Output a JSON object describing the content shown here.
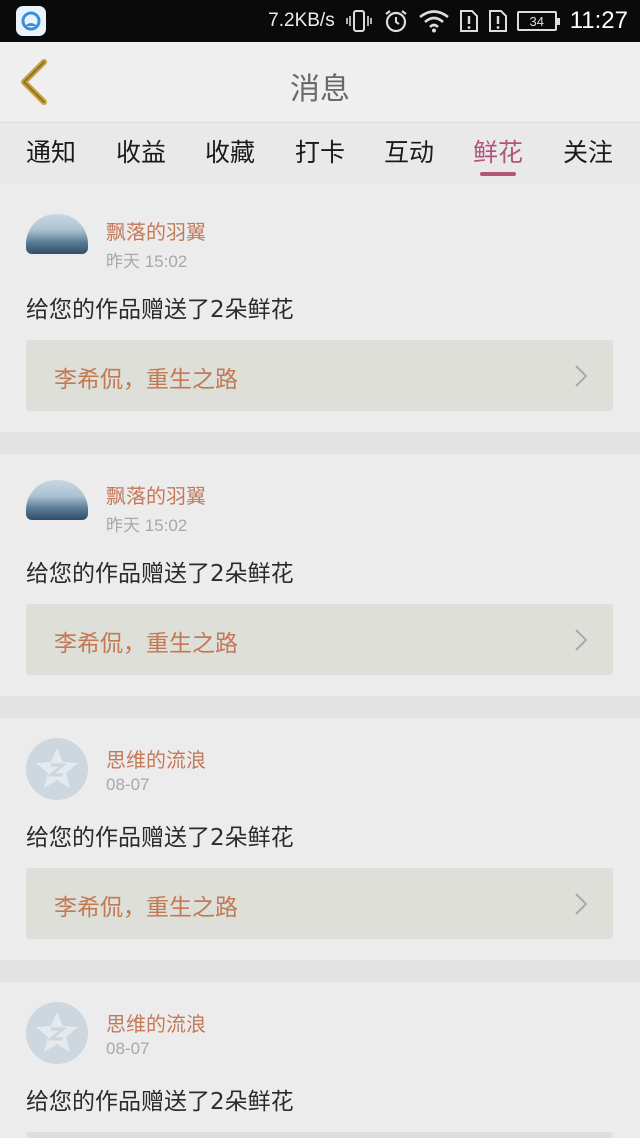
{
  "status_bar": {
    "speed": "7.2KB/s",
    "battery": "34",
    "time": "11:27"
  },
  "header": {
    "title": "消息"
  },
  "tabs": [
    {
      "label": "通知"
    },
    {
      "label": "收益"
    },
    {
      "label": "收藏"
    },
    {
      "label": "打卡"
    },
    {
      "label": "互动"
    },
    {
      "label": "鲜花"
    },
    {
      "label": "关注"
    }
  ],
  "active_tab": "鲜花",
  "messages": [
    {
      "user": "飘落的羽翼",
      "time": "昨天 15:02",
      "text": "给您的作品赠送了2朵鲜花",
      "work": "李希侃，重生之路"
    },
    {
      "user": "飘落的羽翼",
      "time": "昨天 15:02",
      "text": "给您的作品赠送了2朵鲜花",
      "work": "李希侃，重生之路"
    },
    {
      "user": "思维的流浪",
      "time": "08-07",
      "text": "给您的作品赠送了2朵鲜花",
      "work": "李希侃，重生之路"
    },
    {
      "user": "思维的流浪",
      "time": "08-07",
      "text": "给您的作品赠送了2朵鲜花"
    }
  ],
  "colors": {
    "accent": "#b2557a",
    "username": "#c47a5a",
    "work_title": "#c27954"
  }
}
